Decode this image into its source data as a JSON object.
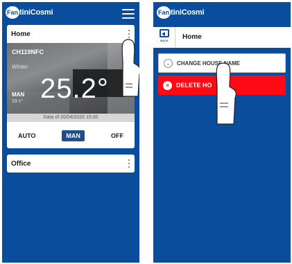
{
  "left_screen": {
    "logo": {
      "badge": "Fan",
      "text": "tiniCosmi"
    },
    "menu_icon": "hamburger-menu-icon",
    "home_card": {
      "title": "Home",
      "device_name": "CH119NFC",
      "season": "Winter",
      "mode": "MAN",
      "setpoint": "19 c°",
      "temperature": "25.2°",
      "date_text": "Data of 20/04/2020 15:00",
      "modes": [
        "AUTO",
        "MAN",
        "OFF"
      ],
      "active_mode": "MAN"
    },
    "office_card": {
      "title": "Office"
    }
  },
  "right_screen": {
    "logo": {
      "badge": "Fan",
      "text": "tiniCosmi"
    },
    "back_label": "BACK",
    "title": "Home",
    "actions": {
      "change_name": "CHANGE HOUSE NAME",
      "delete": "DELETE HO"
    }
  },
  "colors": {
    "brand_blue": "#0a4d9c",
    "active_mode": "#1d4f8e",
    "delete_red": "#ff0a14"
  }
}
